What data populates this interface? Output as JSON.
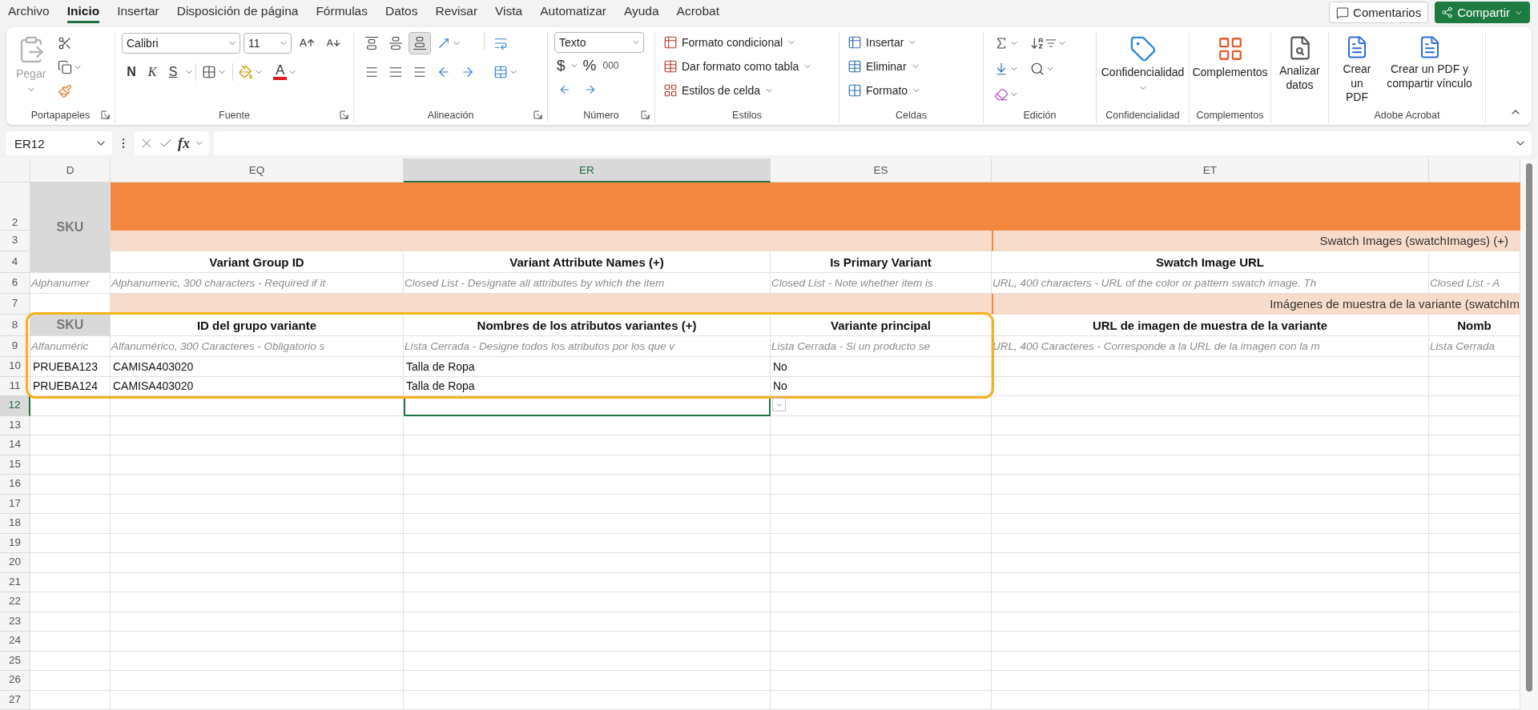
{
  "menu": {
    "tabs": [
      {
        "label": "Archivo",
        "selected": false
      },
      {
        "label": "Inicio",
        "selected": true
      },
      {
        "label": "Insertar",
        "selected": false
      },
      {
        "label": "Disposición de página",
        "selected": false
      },
      {
        "label": "Fórmulas",
        "selected": false
      },
      {
        "label": "Datos",
        "selected": false
      },
      {
        "label": "Revisar",
        "selected": false
      },
      {
        "label": "Vista",
        "selected": false
      },
      {
        "label": "Automatizar",
        "selected": false
      },
      {
        "label": "Ayuda",
        "selected": false
      },
      {
        "label": "Acrobat",
        "selected": false
      }
    ],
    "comments_button": "Comentarios",
    "share_button": "Compartir"
  },
  "ribbon": {
    "clipboard": {
      "label": "Portapapeles",
      "paste": "Pegar",
      "paste_disabled": true
    },
    "font": {
      "label": "Fuente",
      "font_name": "Calibri",
      "font_size": "11",
      "bold": "N",
      "italic": "K",
      "underline": "S",
      "font_color": "A"
    },
    "alignment": {
      "label": "Alineación",
      "vertical": [
        {
          "selected": false
        },
        {
          "selected": false
        },
        {
          "selected": true
        }
      ]
    },
    "number": {
      "label": "Número",
      "format": "Texto",
      "currency": "$",
      "percent": "%",
      "thousands": "000"
    },
    "styles": {
      "label": "Estilos",
      "items": [
        "Formato condicional",
        "Dar formato como tabla",
        "Estilos de celda"
      ]
    },
    "cells": {
      "label": "Celdas",
      "items": [
        "Insertar",
        "Eliminar",
        "Formato"
      ]
    },
    "editing": {
      "label": "Edición"
    },
    "sensitivity": {
      "label": "Confidencialidad",
      "button": "Confidencialidad"
    },
    "addins": {
      "label": "Complementos",
      "button": "Complementos"
    },
    "analyze": {
      "button": "Analizar datos"
    },
    "acrobat": {
      "label": "Adobe Acrobat",
      "buttons": [
        "Crear un PDF",
        "Crear un PDF y compartir vínculo"
      ]
    }
  },
  "formula_bar": {
    "name_box": "ER12",
    "function_label": "fx"
  },
  "sheet": {
    "highlight_frame": {
      "shown": true
    },
    "columns": [
      {
        "label": "D",
        "selected": false
      },
      {
        "label": "EQ",
        "selected": false
      },
      {
        "label": "ER",
        "selected": true
      },
      {
        "label": "ES",
        "selected": false
      },
      {
        "label": "ET",
        "selected": false
      }
    ],
    "rows": [
      {
        "number": "2",
        "kind": "banner",
        "label": "SKU",
        "selected": false
      },
      {
        "number": "3",
        "kind": "band",
        "text": "Swatch Images (swatchImages) (+)",
        "selected": false
      },
      {
        "number": "4",
        "kind": "header",
        "cells": [
          "Variant Group ID",
          "Variant Attribute Names (+)",
          "Is Primary Variant",
          "Swatch Image URL"
        ],
        "selected": false
      },
      {
        "number": "6",
        "kind": "hint",
        "cells": [
          "Alphanumer",
          "Alphanumeric, 300 characters - Required if it",
          "Closed List - Designate all attributes by which the item",
          "Closed List - Note whether item is",
          "URL, 400 characters - URL of the color or pattern swatch image. Th",
          "Closed List - A"
        ],
        "selected": false
      },
      {
        "number": "7",
        "kind": "band",
        "text": "Imágenes de muestra de la variante (swatchIm",
        "selected": false
      },
      {
        "number": "8",
        "kind": "header",
        "cells": [
          "SKU",
          "ID del grupo variante",
          "Nombres de los atributos variantes (+)",
          "Variante principal",
          "URL de imagen de muestra de la variante",
          "Nomb"
        ],
        "selected": false
      },
      {
        "number": "9",
        "kind": "hint",
        "cells": [
          "Alfanuméric",
          "Alfanumérico, 300 Caracteres - Obligatorio s",
          "Lista Cerrada - Designe todos los atributos por los que v",
          "Lista Cerrada - Si un producto se",
          "URL, 400 Caracteres - Corresponde a la URL de la imagen con la m",
          "Lista Cerrada"
        ],
        "selected": false
      },
      {
        "number": "10",
        "kind": "data",
        "cells": [
          "PRUEBA123",
          "CAMISA403020",
          "Talla de Ropa",
          "No"
        ],
        "selected": false
      },
      {
        "number": "11",
        "kind": "data",
        "cells": [
          "PRUEBA124",
          "CAMISA403020",
          "Talla de Ropa",
          "No"
        ],
        "selected": false
      },
      {
        "number": "12",
        "kind": "data",
        "selected": true
      },
      {
        "number": "13",
        "kind": "data",
        "selected": false
      },
      {
        "number": "14",
        "kind": "data",
        "selected": false
      },
      {
        "number": "15",
        "kind": "data",
        "selected": false
      },
      {
        "number": "16",
        "kind": "data",
        "selected": false
      },
      {
        "number": "17",
        "kind": "data",
        "selected": false
      },
      {
        "number": "18",
        "kind": "data",
        "selected": false
      },
      {
        "number": "19",
        "kind": "data",
        "selected": false
      },
      {
        "number": "20",
        "kind": "data",
        "selected": false
      },
      {
        "number": "21",
        "kind": "data",
        "selected": false
      },
      {
        "number": "22",
        "kind": "data",
        "selected": false
      },
      {
        "number": "23",
        "kind": "data",
        "selected": false
      },
      {
        "number": "24",
        "kind": "data",
        "selected": false
      },
      {
        "number": "25",
        "kind": "data",
        "selected": false
      },
      {
        "number": "26",
        "kind": "data",
        "selected": false
      },
      {
        "number": "27",
        "kind": "data",
        "selected": false
      }
    ]
  }
}
